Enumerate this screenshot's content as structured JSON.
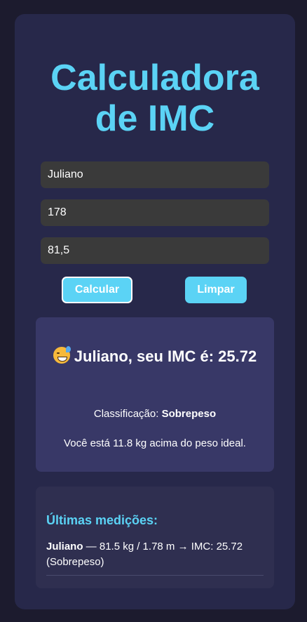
{
  "app": {
    "title_line1": "Calculadora",
    "title_line2": "de IMC"
  },
  "form": {
    "name_value": "Juliano",
    "height_value": "178",
    "weight_value": "81,5",
    "calculate_label": "Calcular",
    "clear_label": "Limpar"
  },
  "result": {
    "emoji_icon": "grinning-face-with-sweat-icon",
    "heading": "Juliano, seu IMC é: 25.72",
    "classification_label": "Classificação:",
    "classification_value": "Sobrepeso",
    "message": "Você está 11.8 kg acima do peso ideal."
  },
  "history": {
    "title": "Últimas medições:",
    "items": [
      {
        "name": "Juliano",
        "details": " — 81.5 kg / 1.78 m → IMC: 25.72 (Sobrepeso)"
      }
    ]
  },
  "colors": {
    "background": "#1c1b2e",
    "card": "#27284a",
    "accent": "#5bd3f5",
    "result_panel": "#383867",
    "history_panel": "#2f2f50",
    "input": "#3a3a3a"
  }
}
